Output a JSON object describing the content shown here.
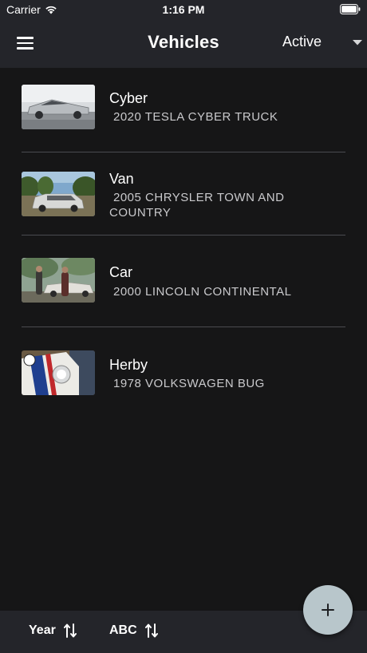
{
  "status_bar": {
    "carrier": "Carrier",
    "time": "1:16 PM"
  },
  "header": {
    "title": "Vehicles",
    "filter_value": "Active"
  },
  "vehicles": [
    {
      "name": "Cyber",
      "description": "2020 TESLA CYBER TRUCK"
    },
    {
      "name": "Van",
      "description": "2005 CHRYSLER TOWN AND COUNTRY"
    },
    {
      "name": "Car",
      "description": "2000 LINCOLN CONTINENTAL"
    },
    {
      "name": "Herby",
      "description": "1978 VOLKSWAGEN BUG"
    }
  ],
  "footer": {
    "sort_year_label": "Year",
    "sort_abc_label": "ABC"
  },
  "colors": {
    "background": "#161617",
    "bar_background": "#24252a",
    "fab": "#b8c6cb"
  }
}
